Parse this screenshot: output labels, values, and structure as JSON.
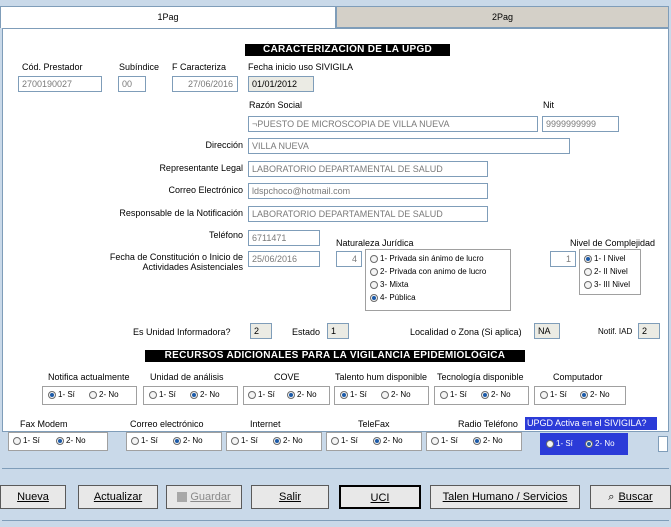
{
  "tabs": [
    {
      "label": "1Pag"
    },
    {
      "label": "2Pag"
    }
  ],
  "caracterizacion": {
    "title": "CARACTERIZACIÓN DE LA UPGD",
    "cod_prestador_label": "Cód. Prestador",
    "cod_prestador_value": "2700190027",
    "subindice_label": "Subíndice",
    "subindice_value": "00",
    "f_caracteriza_label": "F Caracteriza",
    "f_caracteriza_value": "27/06/2016",
    "fecha_inicio_label": "Fecha inicio uso SIVIGILA",
    "fecha_inicio_value": "01/01/2012",
    "razon_social_label": "Razón Social",
    "razon_social_value": "¬PUESTO DE MICROSCOPIA DE VILLA NUEVA",
    "nit_label": "Nit",
    "nit_value": "9999999999",
    "direccion_label": "Dirección",
    "direccion_value": "VILLA NUEVA",
    "representante_label": "Representante Legal",
    "representante_value": "LABORATORIO DEPARTAMENTAL DE SALUD",
    "correo_label": "Correo Electrónico",
    "correo_value": "ldspchoco@hotmail.com",
    "responsable_label": "Responsable de la Notificación",
    "responsable_value": "LABORATORIO DEPARTAMENTAL DE SALUD",
    "telefono_label": "Teléfono",
    "telefono_value": "6711471",
    "fecha_constitucion_label_1": "Fecha de Constitución o Inicio de",
    "fecha_constitucion_label_2": "Actividades Asistenciales",
    "fecha_constitucion_value": "25/06/2016",
    "naturaleza_label": "Naturaleza Jurídica",
    "naturaleza_value": "4",
    "naturaleza_options": [
      {
        "label": "1- Privada sin ánimo de lucro",
        "selected": false
      },
      {
        "label": "2- Privada con animo de lucro",
        "selected": false
      },
      {
        "label": "3- Mixta",
        "selected": false
      },
      {
        "label": "4- Pública",
        "selected": true
      }
    ],
    "complejidad_label": "Nivel de Complejidad",
    "complejidad_value": "1",
    "complejidad_options": [
      {
        "label": "1- I  Nivel",
        "selected": true
      },
      {
        "label": "2- II Nivel",
        "selected": false
      },
      {
        "label": "3- III Nivel",
        "selected": false
      }
    ],
    "unidad_informadora_label": "Es Unidad Informadora?",
    "unidad_informadora_value": "2",
    "estado_label": "Estado",
    "estado_value": "1",
    "localidad_label": "Localidad o Zona (Si aplica)",
    "localidad_value": "NA",
    "notif_iad_label": "Notif. IAD",
    "notif_iad_value": "2"
  },
  "recursos": {
    "title": "RECURSOS ADICIONALES PARA LA VIGILANCIA EPIDEMIOLÓGICA",
    "opt_yes": "1- Sí",
    "opt_no": "2- No",
    "row1": [
      {
        "label": "Notifica actualmente",
        "value": "yes"
      },
      {
        "label": "Unidad de análisis",
        "value": "no"
      },
      {
        "label": "COVE",
        "value": "no"
      },
      {
        "label": "Talento hum disponible",
        "value": "yes"
      },
      {
        "label": "Tecnología disponible",
        "value": "no"
      },
      {
        "label": "Computador",
        "value": "no"
      }
    ],
    "row2": [
      {
        "label": "Fax Modem",
        "value": "no"
      },
      {
        "label": "Correo electrónico",
        "value": "no"
      },
      {
        "label": "Internet",
        "value": "no"
      },
      {
        "label": "TeleFax",
        "value": "no"
      },
      {
        "label": "Radio Teléfono",
        "value": "no"
      }
    ],
    "upgd_activa_label": "UPGD Activa en el SIVIGILA?",
    "upgd_activa_value": "no"
  },
  "toolbar": {
    "nueva": "Nueva",
    "actualizar": "Actualizar",
    "guardar": "Guardar",
    "salir": "Salir",
    "uci": "UCI",
    "talen": "Talen Humano / Servicios",
    "buscar": "Buscar"
  }
}
